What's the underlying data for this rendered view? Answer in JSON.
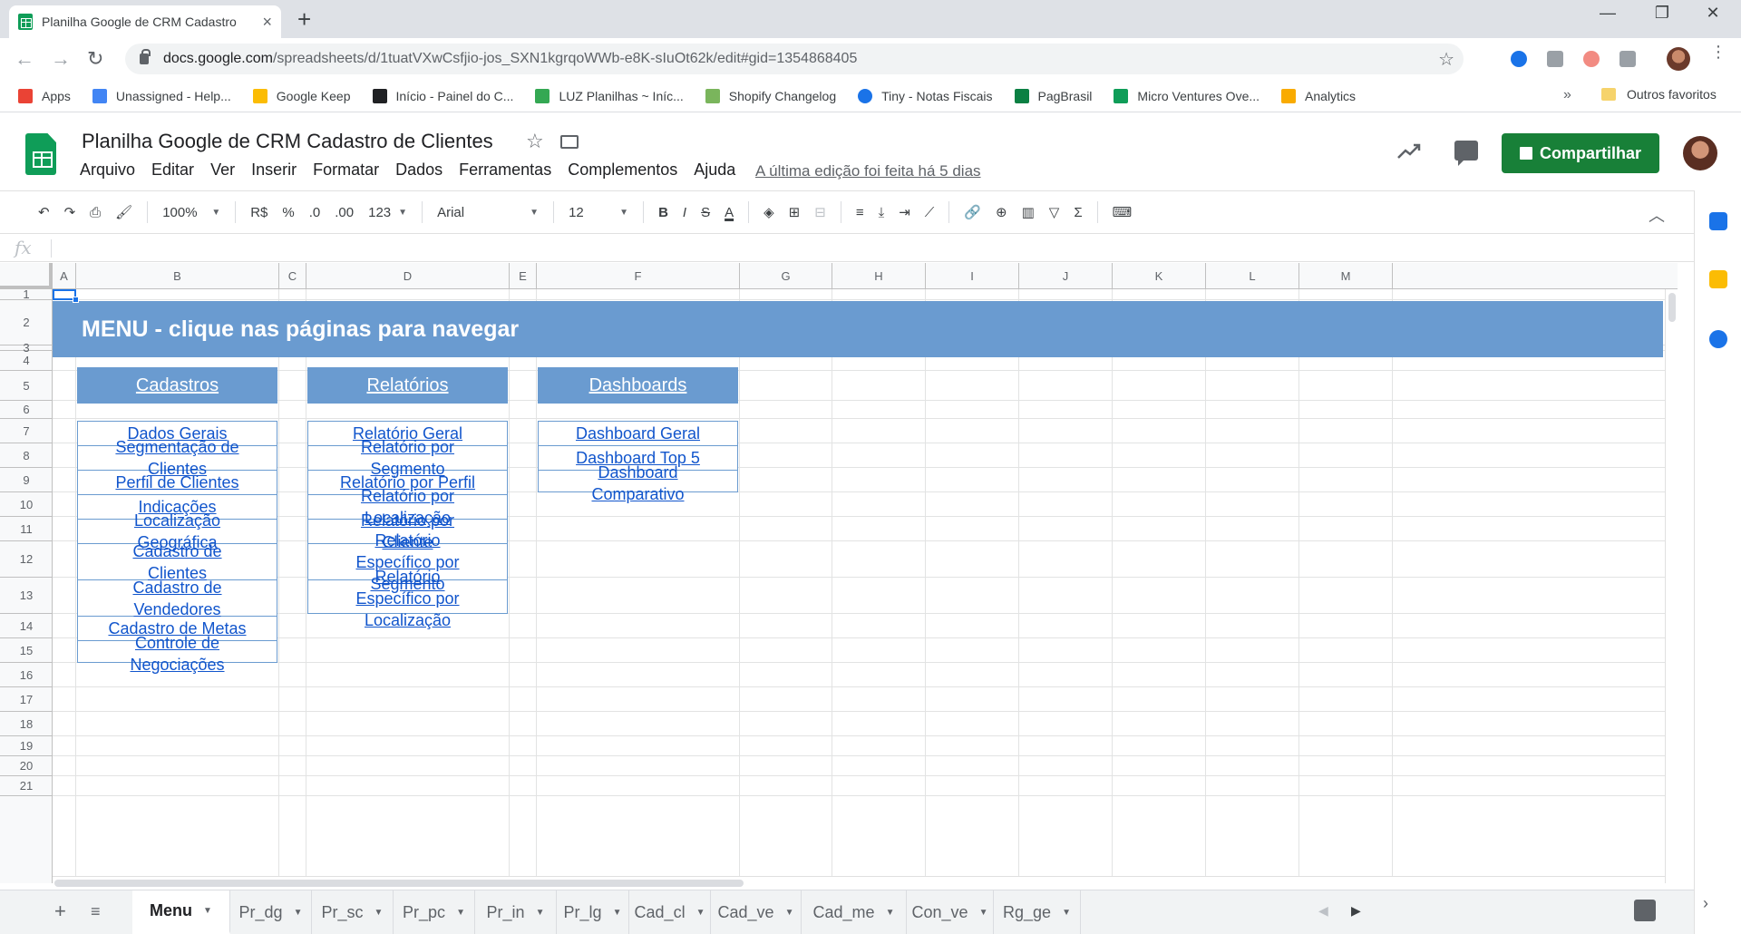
{
  "browser": {
    "tab_title": "Planilha Google de CRM Cadastro",
    "tab_close": "×",
    "new_tab": "+",
    "window_controls": [
      "—",
      "❐",
      "✕"
    ],
    "url_host": "docs.google.com",
    "url_path": "/spreadsheets/d/1tuatVXwCsfjio-jos_SXN1kgrqoWWb-e8K-sIuOt62k/edit#gid=1354868405",
    "bookmarks": [
      {
        "label": "Apps",
        "color": "#ea4335"
      },
      {
        "label": "Unassigned - Help...",
        "color": "#4285f4"
      },
      {
        "label": "Google Keep",
        "color": "#fbbc04"
      },
      {
        "label": "Início - Painel do C...",
        "color": "#202124"
      },
      {
        "label": "LUZ Planilhas ~ Iníc...",
        "color": "#34a853"
      },
      {
        "label": "Shopify Changelog",
        "color": "#7ab55c"
      },
      {
        "label": "Tiny - Notas Fiscais",
        "color": "#1a73e8"
      },
      {
        "label": "PagBrasil",
        "color": "#0b8043"
      },
      {
        "label": "Micro Ventures Ove...",
        "color": "#0f9d58"
      },
      {
        "label": "Analytics",
        "color": "#f9ab00"
      }
    ],
    "bookmarks_more": "»",
    "other_bookmarks": "Outros favoritos"
  },
  "sheets": {
    "doc_title": "Planilha  Google de CRM Cadastro de Clientes",
    "menu": [
      "Arquivo",
      "Editar",
      "Ver",
      "Inserir",
      "Formatar",
      "Dados",
      "Ferramentas",
      "Complementos",
      "Ajuda"
    ],
    "last_edit": "A última edição foi feita há 5 dias",
    "share_label": "Compartilhar"
  },
  "toolbar": {
    "zoom": "100%",
    "currency": "R$",
    "percent": "%",
    "dec_less": ".0",
    "dec_more": ".00",
    "format_more": "123",
    "font": "Arial",
    "font_size": "12",
    "bold": "B",
    "italic": "I",
    "strike": "S",
    "text_color": "A",
    "sum": "Σ"
  },
  "formula_bar": {
    "fx": "fx"
  },
  "grid": {
    "columns": [
      "A",
      "B",
      "C",
      "D",
      "E",
      "F",
      "G",
      "H",
      "I",
      "J",
      "K",
      "L",
      "M"
    ],
    "rows": [
      "1",
      "2",
      "3",
      "4",
      "5",
      "6",
      "7",
      "8",
      "9",
      "10",
      "11",
      "12",
      "13",
      "14",
      "15",
      "16",
      "17",
      "18",
      "19",
      "20",
      "21"
    ],
    "banner": "MENU - clique nas páginas para navegar",
    "sections": [
      {
        "title": "Cadastros",
        "links": [
          "Dados Gerais",
          "Segmentação de Clientes",
          "Perfil de Clientes",
          "Indicações",
          "Localização Geográfica",
          "Cadastro de Clientes",
          "Cadastro de Vendedores",
          "Cadastro de Metas",
          "Controle de Negociações"
        ]
      },
      {
        "title": "Relatórios",
        "links": [
          "Relatório Geral",
          "Relatório por Segmento",
          "Relatório por Perfil",
          "Relatório por Localização",
          "Relatório por Cliente",
          "Relatório Específico por Segmento",
          "Relatório Específico por Localização"
        ]
      },
      {
        "title": "Dashboards",
        "links": [
          "Dashboard Geral",
          "Dashboard Top 5",
          "Dashboard Comparativo"
        ]
      }
    ]
  },
  "sheet_tabs": {
    "add": "+",
    "list": "≡",
    "tabs": [
      "Menu",
      "Pr_dg",
      "Pr_sc",
      "Pr_pc",
      "Pr_in",
      "Pr_lg",
      "Cad_cl",
      "Cad_ve",
      "Cad_me",
      "Con_ve",
      "Rg_ge"
    ],
    "active": "Menu"
  },
  "colors": {
    "header_blue": "#6a9bd0",
    "link_blue": "#1155cc",
    "share_green": "#188038"
  }
}
